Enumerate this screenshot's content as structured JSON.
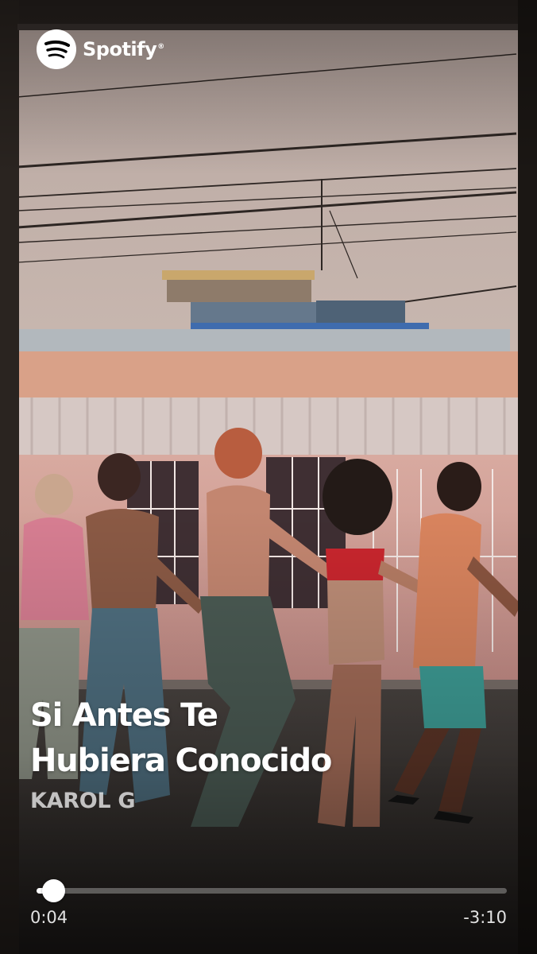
{
  "brand": {
    "name": "Spotify",
    "registered": "®",
    "icon": "spotify-logo-icon",
    "color": "#ffffff"
  },
  "track": {
    "title": "Si Antes Te\nHubiera Conocido",
    "artist": "KAROL G"
  },
  "player": {
    "elapsed": "0:04",
    "remaining": "-3:10",
    "progress_fraction": 0.036
  },
  "colors": {
    "text_primary": "#ffffff",
    "text_secondary": "#cfcac5",
    "track": "#8b8580"
  }
}
